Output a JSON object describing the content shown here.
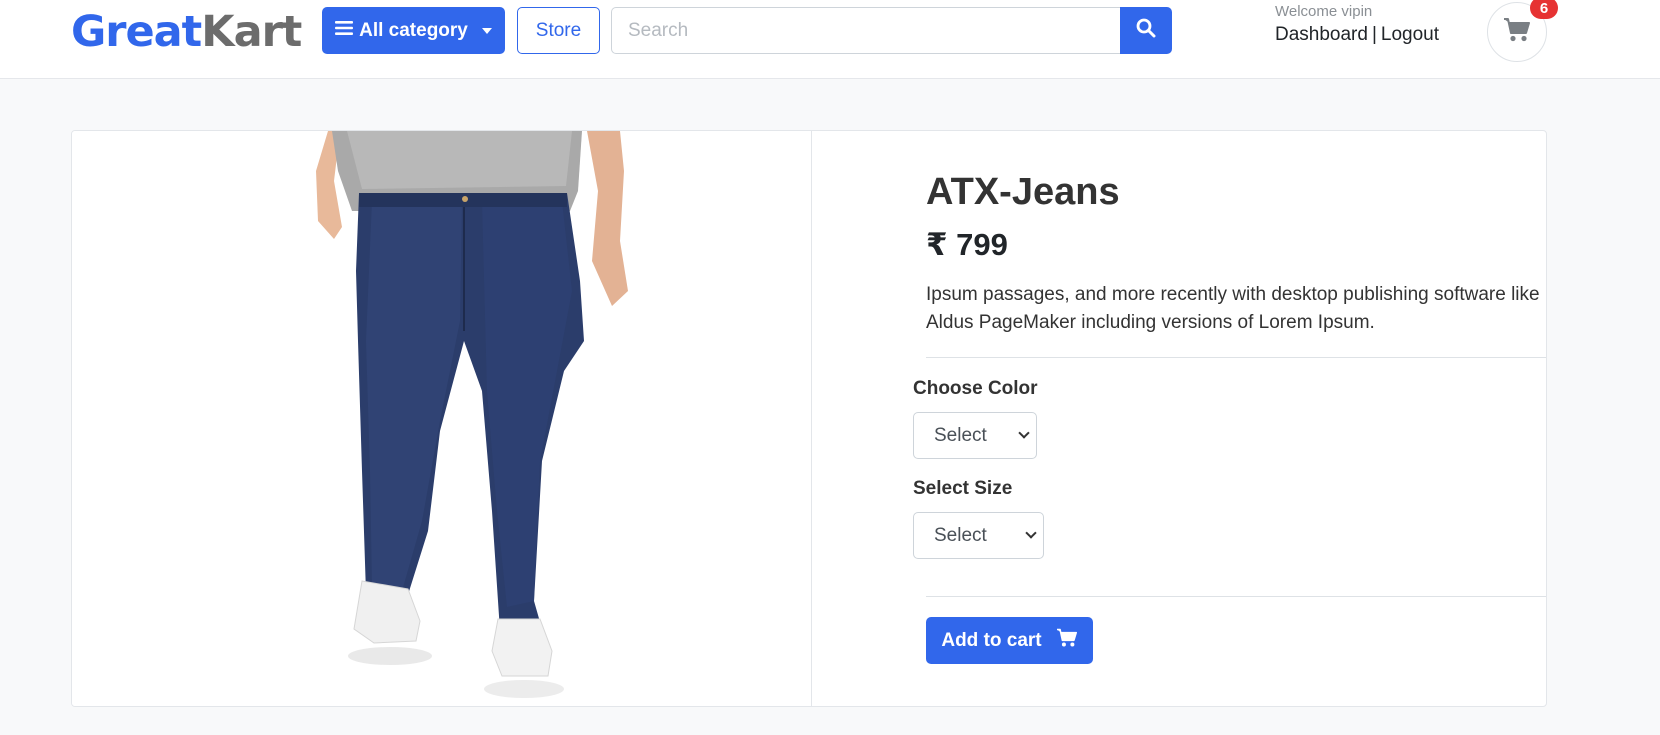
{
  "header": {
    "logo_great": "Great",
    "logo_kart": "Kart",
    "category_label": "All category",
    "store_label": "Store",
    "search_placeholder": "Search",
    "welcome_text": "Welcome vipin",
    "dashboard_label": "Dashboard",
    "separator": "|",
    "logout_label": "Logout",
    "cart_count": "6"
  },
  "product": {
    "title": "ATX-Jeans",
    "price": "₹ 799",
    "description": "Ipsum passages, and more recently with desktop publishing software like Aldus PageMaker including versions of Lorem Ipsum.",
    "color_label": "Choose Color",
    "color_selected": "Select",
    "size_label": "Select Size",
    "size_selected": "Select",
    "add_to_cart_label": "Add to cart"
  },
  "colors": {
    "accent": "#3167eb",
    "badge": "#e63333",
    "logo_secondary": "#6c6c6c"
  },
  "icons": {
    "menu": "bars-icon",
    "search": "search-icon",
    "cart": "shopping-cart-icon"
  }
}
